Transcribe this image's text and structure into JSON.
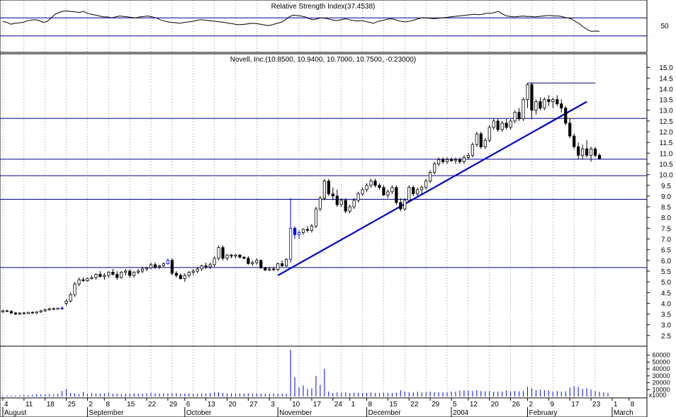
{
  "colors": {
    "background": "#ffffff",
    "frame": "#000000",
    "grid": "#000000",
    "hline": "#00008b",
    "trendline": "#0000cd",
    "candle_up": "#ffffff",
    "candle_down": "#000000",
    "highlight": "#0000ff",
    "volume": "#0000ff",
    "rsi_line": "#000000"
  },
  "chart_data": [
    {
      "type": "line",
      "title": "Relative Strength Index(37.4538)",
      "yticks": [
        "50"
      ],
      "ylim": [
        0,
        100
      ],
      "reference_levels": [
        70,
        30
      ],
      "values": [
        62,
        60,
        56,
        58,
        59,
        60,
        63,
        65,
        66,
        64,
        60,
        62,
        70,
        78,
        82,
        85,
        85,
        84,
        83,
        82,
        84,
        80,
        78,
        76,
        74,
        72,
        72,
        70,
        72,
        74,
        73,
        72,
        71,
        70,
        72,
        73,
        74,
        72,
        70,
        66,
        63,
        61,
        60,
        59,
        58,
        60,
        61,
        62,
        64,
        66,
        65,
        64,
        63,
        62,
        61,
        60,
        58,
        57,
        55,
        55,
        56,
        57,
        58,
        57,
        56,
        54,
        53,
        55,
        58,
        60,
        65,
        72,
        76,
        75,
        74,
        72,
        68,
        66,
        68,
        70,
        69,
        67,
        65,
        64,
        66,
        68,
        66,
        64,
        63,
        64,
        62,
        60,
        58,
        62,
        64,
        66,
        68,
        67,
        64,
        62,
        61,
        63,
        65,
        68,
        70,
        70,
        69,
        68,
        69,
        70,
        71,
        72,
        73,
        74,
        75,
        76,
        77,
        78,
        77,
        78,
        80,
        80,
        82,
        84,
        78,
        74,
        73,
        72,
        73,
        74,
        73,
        73,
        72,
        73,
        74,
        75,
        75,
        74,
        74,
        72,
        70,
        68,
        62,
        57,
        50,
        44,
        40,
        41,
        40
      ]
    },
    {
      "type": "candlestick",
      "title": "Novell, Inc.(10.8500, 10.9400, 10.7000, 10.7500, -0.23000)",
      "ylim": [
        2.0,
        15.5
      ],
      "yticks": [
        "2.5",
        "3.0",
        "3.5",
        "4.0",
        "4.5",
        "5.0",
        "5.5",
        "6.0",
        "6.5",
        "7.0",
        "7.5",
        "8.0",
        "8.5",
        "9.0",
        "9.5",
        "10.0",
        "10.5",
        "11.0",
        "11.5",
        "12.0",
        "12.5",
        "13.0",
        "13.5",
        "14.0",
        "14.5",
        "15.0"
      ],
      "horizontal_levels": [
        5.67,
        8.85,
        9.95,
        10.72,
        12.62
      ],
      "trendline": [
        [
          2003.0001,
          5.3
        ],
        [
          2004.0001,
          13.4
        ]
      ],
      "resistance_segment": {
        "from_index": 124,
        "to_index": 140,
        "value": 14.27
      },
      "ohlc": [
        [
          3.6,
          3.7,
          3.55,
          3.65
        ],
        [
          3.65,
          3.7,
          3.6,
          3.62
        ],
        [
          3.62,
          3.68,
          3.5,
          3.55
        ],
        [
          3.55,
          3.6,
          3.45,
          3.5
        ],
        [
          3.5,
          3.58,
          3.45,
          3.55
        ],
        [
          3.55,
          3.6,
          3.5,
          3.52
        ],
        [
          3.52,
          3.6,
          3.5,
          3.58
        ],
        [
          3.58,
          3.62,
          3.5,
          3.55
        ],
        [
          3.55,
          3.62,
          3.5,
          3.6
        ],
        [
          3.6,
          3.7,
          3.55,
          3.65
        ],
        [
          3.65,
          3.75,
          3.6,
          3.7
        ],
        [
          3.7,
          3.8,
          3.65,
          3.75
        ],
        [
          3.75,
          3.8,
          3.7,
          3.72
        ],
        [
          3.72,
          3.8,
          3.7,
          3.78
        ],
        [
          3.78,
          3.85,
          3.7,
          3.75
        ],
        [
          4.0,
          4.2,
          3.9,
          4.1
        ],
        [
          4.1,
          4.5,
          4.05,
          4.4
        ],
        [
          4.4,
          5.0,
          4.3,
          4.9
        ],
        [
          4.9,
          5.2,
          4.8,
          5.1
        ],
        [
          5.1,
          5.2,
          5.0,
          5.05
        ],
        [
          5.05,
          5.2,
          5.0,
          5.15
        ],
        [
          5.15,
          5.3,
          5.1,
          5.2
        ],
        [
          5.2,
          5.4,
          5.1,
          5.35
        ],
        [
          5.35,
          5.5,
          5.2,
          5.25
        ],
        [
          5.25,
          5.4,
          5.1,
          5.3
        ],
        [
          5.3,
          5.5,
          5.2,
          5.45
        ],
        [
          5.45,
          5.6,
          5.3,
          5.35
        ],
        [
          5.35,
          5.5,
          5.1,
          5.2
        ],
        [
          5.2,
          5.5,
          5.15,
          5.45
        ],
        [
          5.45,
          5.6,
          5.3,
          5.5
        ],
        [
          5.5,
          5.6,
          5.2,
          5.3
        ],
        [
          5.3,
          5.5,
          5.2,
          5.45
        ],
        [
          5.45,
          5.6,
          5.35,
          5.5
        ],
        [
          5.5,
          5.7,
          5.4,
          5.6
        ],
        [
          5.6,
          5.7,
          5.5,
          5.65
        ],
        [
          5.65,
          5.9,
          5.6,
          5.8
        ],
        [
          5.8,
          5.9,
          5.6,
          5.7
        ],
        [
          5.7,
          5.8,
          5.6,
          5.75
        ],
        [
          5.75,
          5.9,
          5.7,
          5.85
        ],
        [
          5.85,
          6.1,
          5.8,
          6.0
        ],
        [
          6.0,
          6.1,
          5.3,
          5.4
        ],
        [
          5.4,
          5.5,
          5.2,
          5.3
        ],
        [
          5.3,
          5.4,
          5.1,
          5.15
        ],
        [
          5.15,
          5.4,
          5.0,
          5.3
        ],
        [
          5.3,
          5.5,
          5.2,
          5.45
        ],
        [
          5.45,
          5.6,
          5.3,
          5.5
        ],
        [
          5.5,
          5.7,
          5.4,
          5.6
        ],
        [
          5.6,
          5.8,
          5.5,
          5.75
        ],
        [
          5.75,
          5.9,
          5.6,
          5.7
        ],
        [
          5.7,
          5.9,
          5.6,
          5.8
        ],
        [
          5.8,
          6.2,
          5.7,
          6.1
        ],
        [
          6.1,
          6.7,
          6.0,
          6.6
        ],
        [
          6.6,
          6.7,
          6.0,
          6.1
        ],
        [
          6.1,
          6.3,
          6.0,
          6.25
        ],
        [
          6.25,
          6.3,
          6.1,
          6.2
        ],
        [
          6.2,
          6.3,
          6.1,
          6.25
        ],
        [
          6.25,
          6.3,
          6.1,
          6.15
        ],
        [
          6.15,
          6.2,
          6.05,
          6.1
        ],
        [
          6.1,
          6.2,
          5.8,
          5.85
        ],
        [
          5.85,
          6.0,
          5.75,
          5.9
        ],
        [
          5.9,
          6.1,
          5.8,
          6.0
        ],
        [
          6.0,
          6.05,
          5.6,
          5.65
        ],
        [
          5.65,
          5.7,
          5.5,
          5.55
        ],
        [
          5.55,
          5.7,
          5.5,
          5.6
        ],
        [
          5.6,
          5.7,
          5.5,
          5.58
        ],
        [
          5.58,
          5.9,
          5.5,
          5.85
        ],
        [
          5.85,
          6.0,
          5.7,
          5.75
        ],
        [
          5.75,
          6.1,
          5.7,
          6.05
        ],
        [
          6.05,
          8.9,
          5.9,
          7.5
        ],
        [
          7.5,
          7.6,
          7.0,
          7.2
        ],
        [
          7.2,
          7.4,
          7.0,
          7.3
        ],
        [
          7.3,
          7.5,
          7.2,
          7.45
        ],
        [
          7.45,
          7.6,
          7.3,
          7.4
        ],
        [
          7.4,
          7.7,
          7.3,
          7.6
        ],
        [
          7.6,
          8.5,
          7.5,
          8.4
        ],
        [
          8.4,
          9.0,
          8.3,
          8.9
        ],
        [
          8.9,
          9.8,
          8.8,
          9.7
        ],
        [
          9.7,
          9.8,
          9.0,
          9.1
        ],
        [
          9.1,
          9.4,
          8.8,
          9.0
        ],
        [
          9.0,
          9.3,
          8.5,
          8.6
        ],
        [
          8.6,
          8.9,
          8.5,
          8.8
        ],
        [
          8.8,
          8.9,
          8.2,
          8.3
        ],
        [
          8.3,
          8.6,
          8.2,
          8.5
        ],
        [
          8.5,
          8.9,
          8.4,
          8.8
        ],
        [
          8.8,
          9.2,
          8.7,
          9.1
        ],
        [
          9.1,
          9.4,
          9.0,
          9.3
        ],
        [
          9.3,
          9.6,
          9.2,
          9.5
        ],
        [
          9.5,
          9.8,
          9.4,
          9.7
        ],
        [
          9.7,
          9.8,
          9.4,
          9.5
        ],
        [
          9.5,
          9.6,
          9.3,
          9.4
        ],
        [
          9.4,
          9.5,
          9.0,
          9.05
        ],
        [
          9.05,
          9.3,
          8.9,
          9.2
        ],
        [
          9.2,
          9.5,
          9.1,
          9.4
        ],
        [
          9.4,
          9.5,
          8.6,
          8.7
        ],
        [
          8.7,
          8.9,
          8.3,
          8.4
        ],
        [
          8.4,
          8.9,
          8.3,
          8.8
        ],
        [
          8.8,
          9.5,
          8.7,
          9.4
        ],
        [
          9.4,
          9.5,
          9.0,
          9.1
        ],
        [
          9.1,
          9.4,
          9.0,
          9.3
        ],
        [
          9.3,
          9.5,
          9.1,
          9.4
        ],
        [
          9.4,
          9.8,
          9.3,
          9.7
        ],
        [
          9.7,
          10.2,
          9.6,
          10.1
        ],
        [
          10.1,
          10.6,
          10.0,
          10.5
        ],
        [
          10.5,
          10.8,
          10.4,
          10.7
        ],
        [
          10.7,
          10.8,
          10.5,
          10.6
        ],
        [
          10.6,
          10.8,
          10.5,
          10.7
        ],
        [
          10.7,
          10.8,
          10.6,
          10.65
        ],
        [
          10.65,
          10.8,
          10.5,
          10.7
        ],
        [
          10.7,
          10.8,
          10.5,
          10.6
        ],
        [
          10.6,
          10.9,
          10.5,
          10.8
        ],
        [
          10.8,
          11.0,
          10.7,
          10.9
        ],
        [
          10.9,
          11.5,
          10.8,
          11.4
        ],
        [
          11.4,
          12.0,
          11.3,
          11.9
        ],
        [
          11.9,
          12.0,
          11.2,
          11.3
        ],
        [
          11.3,
          11.7,
          11.2,
          11.6
        ],
        [
          11.6,
          12.3,
          11.5,
          12.2
        ],
        [
          12.2,
          12.6,
          12.1,
          12.5
        ],
        [
          12.5,
          12.6,
          12.0,
          12.1
        ],
        [
          12.1,
          12.5,
          12.0,
          12.4
        ],
        [
          12.4,
          12.6,
          12.1,
          12.2
        ],
        [
          12.2,
          12.6,
          12.1,
          12.5
        ],
        [
          12.5,
          13.0,
          12.4,
          12.9
        ],
        [
          12.9,
          13.1,
          12.5,
          12.6
        ],
        [
          12.6,
          13.6,
          12.5,
          13.5
        ],
        [
          13.5,
          14.27,
          13.1,
          14.2
        ],
        [
          14.2,
          14.3,
          12.6,
          13.0
        ],
        [
          13.0,
          13.5,
          12.8,
          13.4
        ],
        [
          13.4,
          13.6,
          13.0,
          13.1
        ],
        [
          13.1,
          13.6,
          13.0,
          13.5
        ],
        [
          13.5,
          13.7,
          13.2,
          13.4
        ],
        [
          13.4,
          13.6,
          13.1,
          13.5
        ],
        [
          13.5,
          13.7,
          13.2,
          13.3
        ],
        [
          13.3,
          13.5,
          12.9,
          13.1
        ],
        [
          13.1,
          13.2,
          12.3,
          12.4
        ],
        [
          12.4,
          12.6,
          11.7,
          11.8
        ],
        [
          11.8,
          11.9,
          11.2,
          11.3
        ],
        [
          11.3,
          11.5,
          10.7,
          10.9
        ],
        [
          10.9,
          11.4,
          10.7,
          11.2
        ],
        [
          11.2,
          11.6,
          10.8,
          10.9
        ],
        [
          10.9,
          11.3,
          10.6,
          11.2
        ],
        [
          11.2,
          11.3,
          10.8,
          10.9
        ],
        [
          10.9,
          11.0,
          10.7,
          10.75
        ]
      ],
      "highlight_indices": [
        14,
        39,
        68,
        69,
        70
      ]
    },
    {
      "type": "bar",
      "title": "",
      "yticks": [
        "60000",
        "50000",
        "40000",
        "30000",
        "20000",
        "10000"
      ],
      "unit_label": "x1000",
      "values": [
        1000,
        1500,
        1500,
        1500,
        2000,
        2500,
        2000,
        2500,
        3000,
        3000,
        3500,
        3500,
        3000,
        4000,
        8000,
        11000,
        5000,
        4500,
        3500,
        6500,
        4000,
        5000,
        4000,
        4000,
        4500,
        5500,
        4000,
        4000,
        3500,
        4000,
        4000,
        4500,
        4000,
        4000,
        4500,
        5500,
        4500,
        4500,
        4500,
        4500,
        5000,
        5000,
        4000,
        4000,
        4500,
        4000,
        4000,
        4500,
        4500,
        5000,
        6000,
        6000,
        5000,
        4500,
        4500,
        4500,
        4000,
        4000,
        4500,
        4000,
        4500,
        4000,
        4000,
        4000,
        4500,
        4000,
        4000,
        4000,
        68000,
        28000,
        13000,
        16000,
        11000,
        12000,
        30000,
        17000,
        40000,
        7000,
        5000,
        6000,
        5500,
        6000,
        5000,
        5500,
        5000,
        5000,
        5000,
        5500,
        5000,
        5000,
        5500,
        5000,
        5000,
        5500,
        9000,
        7000,
        6000,
        6000,
        7000,
        6000,
        6500,
        7000,
        6500,
        6000,
        6000,
        6000,
        7000,
        7000,
        8500,
        9000,
        8500,
        8000,
        9000,
        8000,
        7500,
        8000,
        7000,
        7000,
        7000,
        9000,
        7500,
        8000,
        7500,
        8000,
        14000,
        12000,
        9000,
        10000,
        9000,
        9000,
        7000,
        8000,
        7000,
        7500,
        13000,
        15000,
        14000,
        11000,
        12000,
        10000,
        8000,
        7000,
        6000,
        5000
      ],
      "x_day_labels": [
        "4",
        "11",
        "18",
        "25",
        "2",
        "8",
        "15",
        "22",
        "29",
        "6",
        "13",
        "20",
        "27",
        "3",
        "10",
        "17",
        "24",
        "1",
        "8",
        "15",
        "22",
        "29",
        "5",
        "12",
        "20",
        "26",
        "2",
        "9",
        "17",
        "23",
        "1",
        "8"
      ],
      "month_labels": [
        "August",
        "September",
        "October",
        "November",
        "December",
        "2004",
        "February",
        "March"
      ]
    }
  ]
}
